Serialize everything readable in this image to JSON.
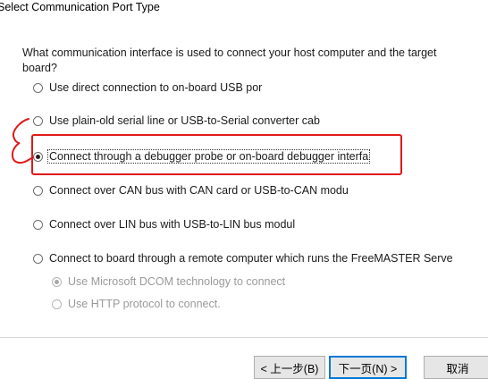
{
  "window": {
    "title": "Select Communication Port Type"
  },
  "question": "What communication interface is used to connect your host computer and the target board?",
  "options": [
    {
      "label": "Use direct connection to on-board USB por",
      "selected": false,
      "enabled": true
    },
    {
      "label": "Use plain-old serial line or USB-to-Serial converter cab",
      "selected": false,
      "enabled": true
    },
    {
      "label": "Connect through a debugger probe or on-board debugger interfa",
      "selected": true,
      "enabled": true
    },
    {
      "label": "Connect over CAN bus with CAN card or USB-to-CAN modu",
      "selected": false,
      "enabled": true
    },
    {
      "label": "Connect over LIN bus with USB-to-LIN bus modul",
      "selected": false,
      "enabled": true
    },
    {
      "label": "Connect to board through a remote computer which runs the FreeMASTER Serve",
      "selected": false,
      "enabled": true
    }
  ],
  "sub_options": [
    {
      "label": "Use Microsoft DCOM technology to connect",
      "selected": true,
      "enabled": false
    },
    {
      "label": "Use HTTP protocol to connect.",
      "selected": false,
      "enabled": false
    }
  ],
  "buttons": {
    "back": "< 上一步(B)",
    "next": "下一页(N) >",
    "cancel": "取消"
  },
  "colors": {
    "annotation": "#e01818",
    "default_button_border": "#0078d7"
  }
}
